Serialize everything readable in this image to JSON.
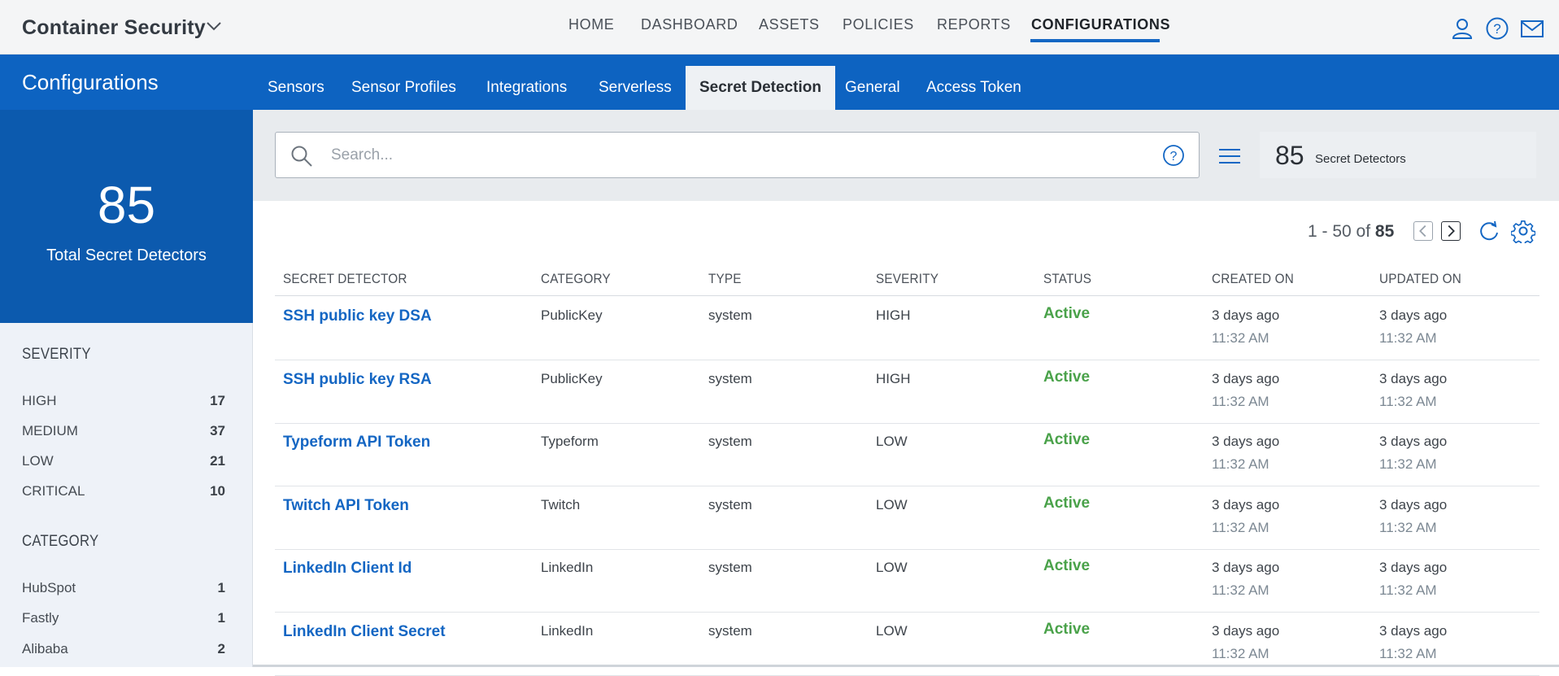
{
  "app": {
    "title": "Container Security"
  },
  "topnav": [
    "HOME",
    "DASHBOARD",
    "ASSETS",
    "POLICIES",
    "REPORTS",
    "CONFIGURATIONS"
  ],
  "topnav_active": "CONFIGURATIONS",
  "page": {
    "title": "Configurations"
  },
  "subtabs": [
    "Sensors",
    "Sensor Profiles",
    "Integrations",
    "Serverless",
    "Secret Detection",
    "General",
    "Access Token"
  ],
  "subtab_active": "Secret Detection",
  "summary_card": {
    "count": "85",
    "label": "Total Secret Detectors"
  },
  "filters": {
    "severity": {
      "title": "SEVERITY",
      "items": [
        {
          "label": "HIGH",
          "count": "17"
        },
        {
          "label": "MEDIUM",
          "count": "37"
        },
        {
          "label": "LOW",
          "count": "21"
        },
        {
          "label": "CRITICAL",
          "count": "10"
        }
      ]
    },
    "category": {
      "title": "CATEGORY",
      "items": [
        {
          "label": "HubSpot",
          "count": "1"
        },
        {
          "label": "Fastly",
          "count": "1"
        },
        {
          "label": "Alibaba",
          "count": "2"
        }
      ]
    }
  },
  "search": {
    "placeholder": "Search..."
  },
  "results": {
    "count": "85",
    "label": "Secret Detectors"
  },
  "pagination": {
    "range": "1 - 50 of",
    "total": "85"
  },
  "table": {
    "columns": [
      "SECRET DETECTOR",
      "CATEGORY",
      "TYPE",
      "SEVERITY",
      "STATUS",
      "CREATED ON",
      "UPDATED ON"
    ],
    "rows": [
      {
        "name": "SSH public key DSA",
        "category": "PublicKey",
        "type": "system",
        "severity": "HIGH",
        "status": "Active",
        "created_date": "3 days ago",
        "created_time": "11:32 AM",
        "updated_date": "3 days ago",
        "updated_time": "11:32 AM"
      },
      {
        "name": "SSH public key RSA",
        "category": "PublicKey",
        "type": "system",
        "severity": "HIGH",
        "status": "Active",
        "created_date": "3 days ago",
        "created_time": "11:32 AM",
        "updated_date": "3 days ago",
        "updated_time": "11:32 AM"
      },
      {
        "name": "Typeform API Token",
        "category": "Typeform",
        "type": "system",
        "severity": "LOW",
        "status": "Active",
        "created_date": "3 days ago",
        "created_time": "11:32 AM",
        "updated_date": "3 days ago",
        "updated_time": "11:32 AM"
      },
      {
        "name": "Twitch API Token",
        "category": "Twitch",
        "type": "system",
        "severity": "LOW",
        "status": "Active",
        "created_date": "3 days ago",
        "created_time": "11:32 AM",
        "updated_date": "3 days ago",
        "updated_time": "11:32 AM"
      },
      {
        "name": "LinkedIn Client Id",
        "category": "LinkedIn",
        "type": "system",
        "severity": "LOW",
        "status": "Active",
        "created_date": "3 days ago",
        "created_time": "11:32 AM",
        "updated_date": "3 days ago",
        "updated_time": "11:32 AM"
      },
      {
        "name": "LinkedIn Client Secret",
        "category": "LinkedIn",
        "type": "system",
        "severity": "LOW",
        "status": "Active",
        "created_date": "3 days ago",
        "created_time": "11:32 AM",
        "updated_date": "3 days ago",
        "updated_time": "11:32 AM"
      }
    ]
  },
  "colors": {
    "primary": "#0d63c1",
    "panel": "#0c5aae",
    "link": "#1466c3",
    "active_status": "#4aa24a"
  },
  "icons": [
    "chevron-down-icon",
    "user-icon",
    "help-icon",
    "mail-icon",
    "search-icon",
    "menu-icon",
    "chevron-left-icon",
    "chevron-right-icon",
    "refresh-icon",
    "settings-icon"
  ]
}
